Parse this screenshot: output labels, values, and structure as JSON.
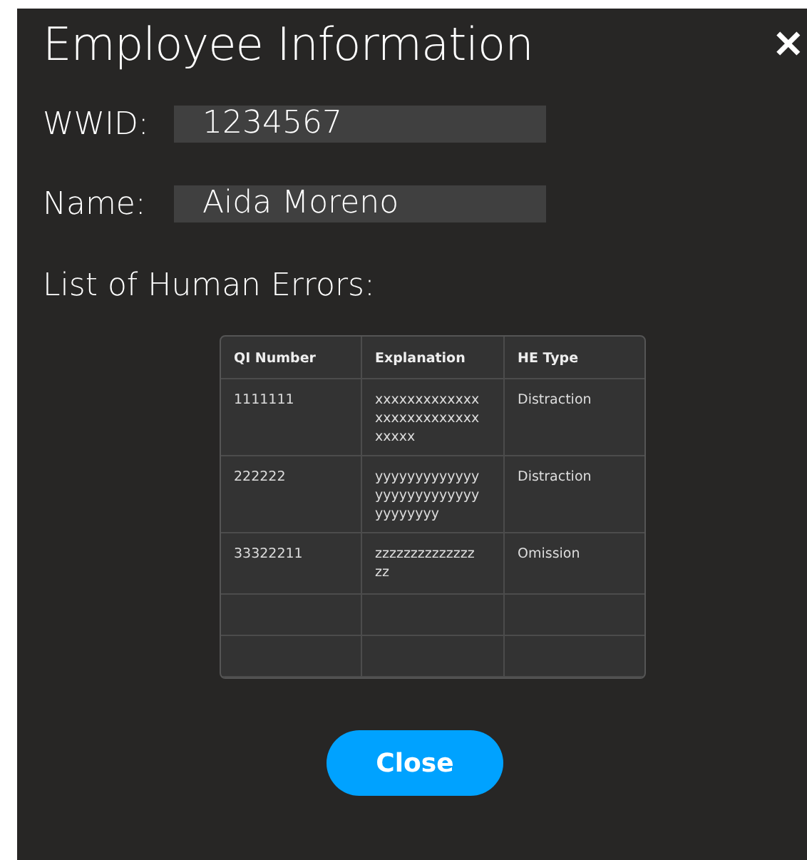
{
  "dialog": {
    "title": "Employee Information",
    "close_icon": "✕"
  },
  "fields": [
    {
      "label": "WWID:",
      "value": "1234567"
    },
    {
      "label": "Name:",
      "value": "Aida Moreno"
    }
  ],
  "section_title": "List of Human Errors:",
  "table": {
    "columns": [
      "QI Number",
      "Explanation",
      "HE Type"
    ],
    "rows": [
      {
        "kind": "data",
        "cells": [
          "1111111",
          "xxxxxxxxxxxxxxxxxxxxxxxxxxxxxxx",
          "Distraction"
        ]
      },
      {
        "kind": "data",
        "cells": [
          "222222",
          "yyyyyyyyyyyyyyyyyyyyyyyyyyyyyyyyyy",
          "Distraction"
        ]
      },
      {
        "kind": "data",
        "cells": [
          "33322211",
          "zzzzzzzzzzzzzzzz",
          "Omission"
        ]
      },
      {
        "kind": "blank"
      },
      {
        "kind": "blank"
      }
    ]
  },
  "buttons": [
    "Close"
  ]
}
